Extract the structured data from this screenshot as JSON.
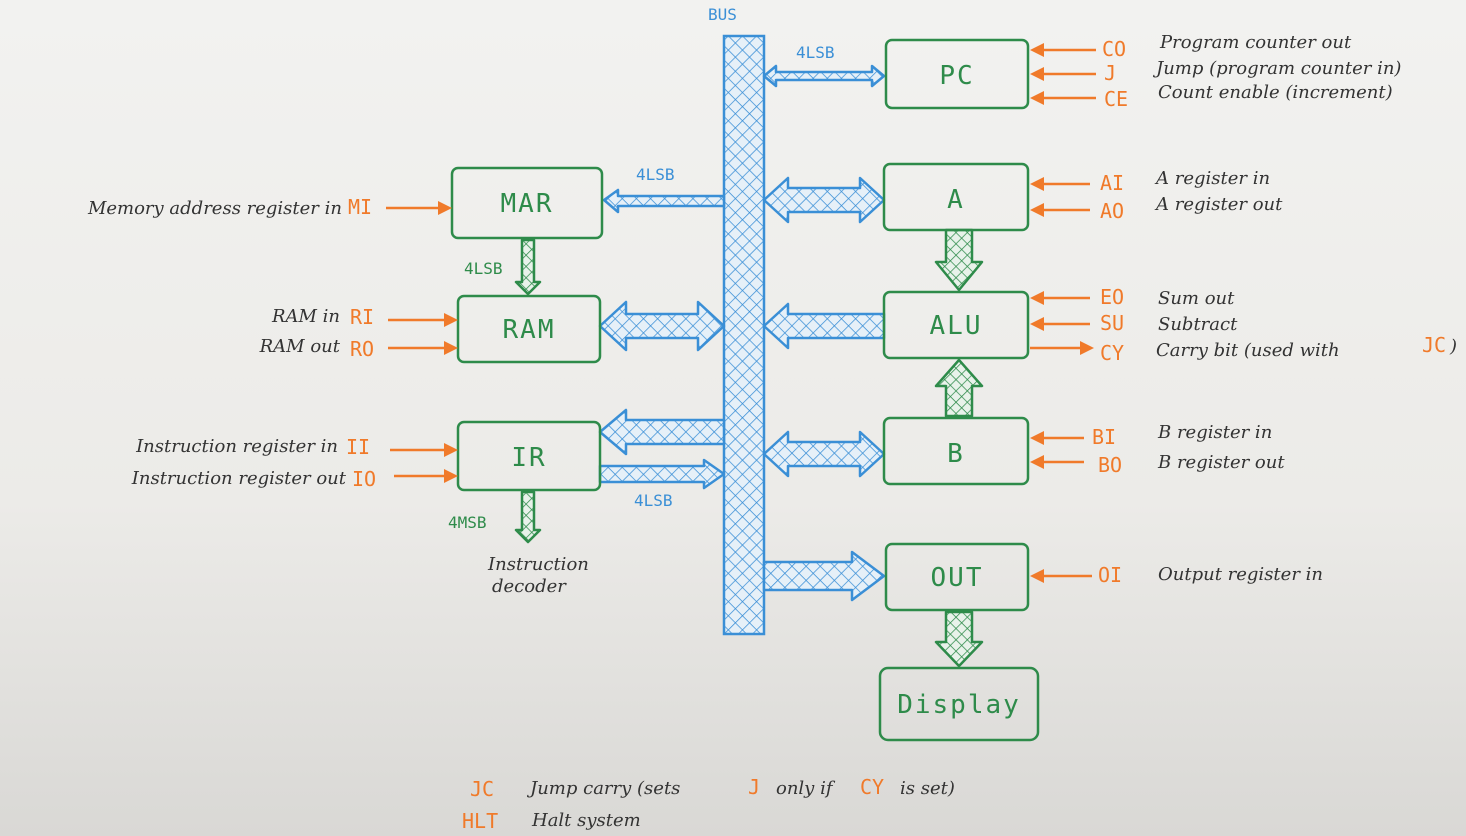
{
  "bus_label": "BUS",
  "blocks": {
    "pc": "PC",
    "mar": "MAR",
    "ram": "RAM",
    "ir": "IR",
    "a": "A",
    "alu": "ALU",
    "b": "B",
    "out": "OUT",
    "display": "Display"
  },
  "bus_widths": {
    "pc": "4LSB",
    "mar": "4LSB",
    "mar_to_ram": "4LSB",
    "ir_to_bus": "4LSB",
    "ir_decoder": "4MSB"
  },
  "decoder_label_1": "Instruction",
  "decoder_label_2": "decoder",
  "left_signals": {
    "mi": {
      "code": "MI",
      "desc": "Memory address register in"
    },
    "ri": {
      "code": "RI",
      "desc": "RAM in"
    },
    "ro": {
      "code": "RO",
      "desc": "RAM out"
    },
    "ii": {
      "code": "II",
      "desc": "Instruction register in"
    },
    "io": {
      "code": "IO",
      "desc": "Instruction register out"
    }
  },
  "right_signals": {
    "co": {
      "code": "CO",
      "desc": "Program counter out"
    },
    "j": {
      "code": "J",
      "desc": "Jump (program counter in)"
    },
    "ce": {
      "code": "CE",
      "desc": "Count enable (increment)"
    },
    "ai": {
      "code": "AI",
      "desc": "A register in"
    },
    "ao": {
      "code": "AO",
      "desc": "A register out"
    },
    "eo": {
      "code": "EO",
      "desc": "Sum out"
    },
    "su": {
      "code": "SU",
      "desc": "Subtract"
    },
    "cy": {
      "code": "CY",
      "desc": "Carry bit (used with",
      "ref": "JC",
      "close": ")"
    },
    "bi": {
      "code": "BI",
      "desc": "B register in"
    },
    "bo": {
      "code": "BO",
      "desc": "B register out"
    },
    "oi": {
      "code": "OI",
      "desc": "Output register in"
    }
  },
  "footer": {
    "jc_code": "JC",
    "jc_text_1": "Jump carry (sets",
    "jc_ref_j": "J",
    "jc_text_2": "only if",
    "jc_ref_cy": "CY",
    "jc_text_3": "is set)",
    "hlt_code": "HLT",
    "hlt_text": "Halt system"
  },
  "colors": {
    "blocks": "#2e8b4a",
    "bus": "#3a8fd6",
    "signals": "#f07a2a",
    "text": "#333333"
  }
}
